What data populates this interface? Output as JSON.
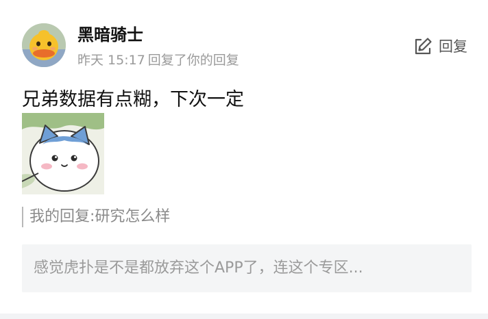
{
  "comment": {
    "username": "黑暗骑士",
    "timestamp": "昨天 15:17",
    "action_text": "回复了你的回复",
    "reply_button_label": "回复",
    "reply_icon": "edit-reply-icon",
    "content_text": "兄弟数据有点糊，下次一定",
    "sticker_icon": "cat-sticker",
    "quote_text": "我的回复:研究怎么样",
    "parent_text": "感觉虎扑是不是都放弃这个APP了，连这个专区..."
  },
  "colors": {
    "username": "#111111",
    "meta": "#9a9a9a",
    "quote_bar": "#b8b8b8",
    "parent_background": "#f4f5f6",
    "divider": "#f2f3f5"
  }
}
